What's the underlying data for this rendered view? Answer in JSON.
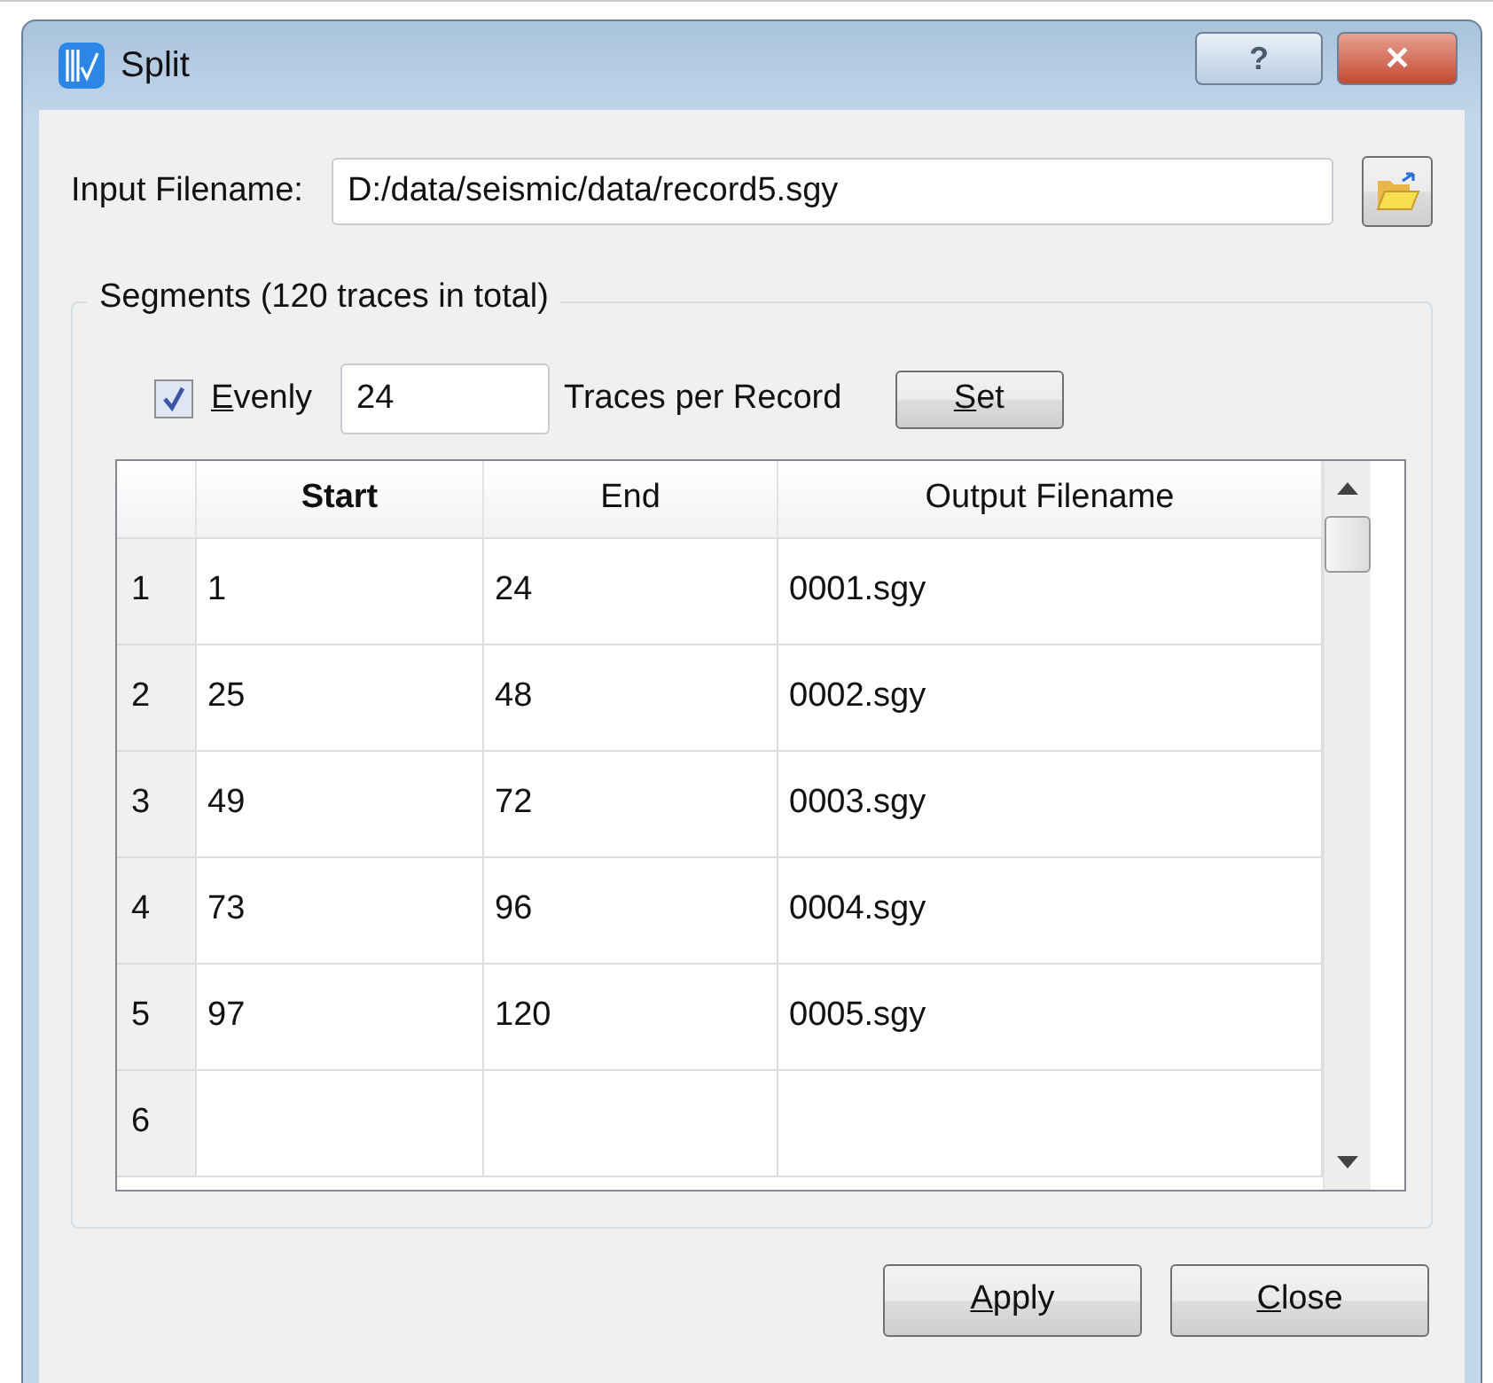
{
  "window": {
    "title": "Split",
    "buttons": [
      {
        "kind": "help",
        "label": "?"
      },
      {
        "kind": "close",
        "label": "✕"
      }
    ]
  },
  "input": {
    "label": "Input Filename:",
    "value": "D:/data/seismic/data/record5.sgy"
  },
  "segments": {
    "title": "Segments (120 traces in total)",
    "evenly": {
      "label": "Evenly",
      "underline_first": true,
      "checked": true
    },
    "traces": {
      "value": "24",
      "label": "Traces per Record"
    },
    "set_button": {
      "label": "Set",
      "underline_first": true
    },
    "table": {
      "columns": [
        {
          "label": "Start",
          "bold": true
        },
        {
          "label": "End",
          "bold": false
        },
        {
          "label": "Output Filename",
          "bold": false
        }
      ],
      "rows": [
        {
          "header": "1",
          "cells": [
            "1",
            "24",
            "0001.sgy"
          ]
        },
        {
          "header": "2",
          "cells": [
            "25",
            "48",
            "0002.sgy"
          ]
        },
        {
          "header": "3",
          "cells": [
            "49",
            "72",
            "0003.sgy"
          ]
        },
        {
          "header": "4",
          "cells": [
            "73",
            "96",
            "0004.sgy"
          ]
        },
        {
          "header": "5",
          "cells": [
            "97",
            "120",
            "0005.sgy"
          ]
        },
        {
          "header": "6",
          "cells": [
            "",
            "",
            ""
          ]
        }
      ]
    }
  },
  "buttons": [
    {
      "label": "Apply",
      "underline_first": true
    },
    {
      "label": "Close",
      "underline_first": true
    }
  ]
}
